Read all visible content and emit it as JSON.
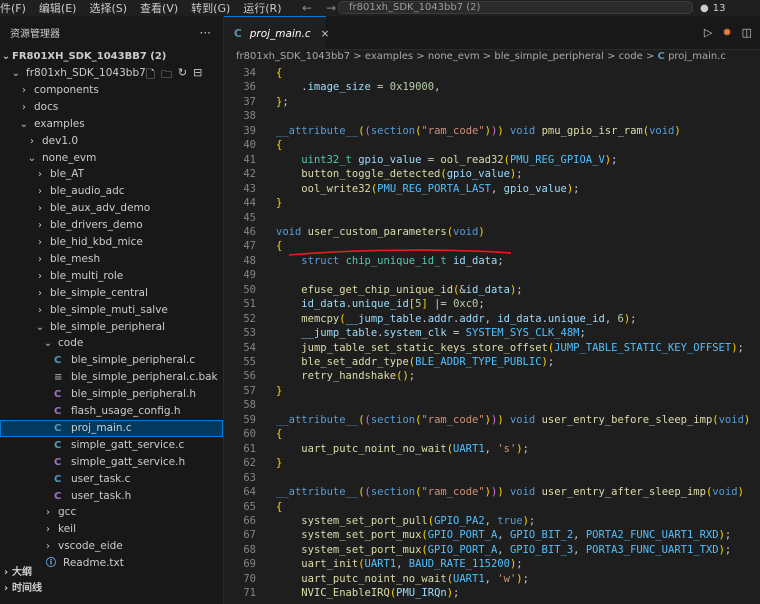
{
  "menubar": {
    "items": [
      "件(F)",
      "编辑(E)",
      "选择(S)",
      "查看(V)",
      "转到(G)",
      "运行(R)"
    ]
  },
  "command_center": {
    "text": "fr801xh_SDK_1043bb7 (2)"
  },
  "notification_count": "13",
  "explorer": {
    "title": "资源管理器",
    "root": "FR801XH_SDK_1043BB7 (2)",
    "tree": [
      {
        "label": "fr801xh_SDK_1043bb7",
        "kind": "folder-open",
        "depth": 1
      },
      {
        "label": "components",
        "kind": "folder",
        "depth": 2
      },
      {
        "label": "docs",
        "kind": "folder",
        "depth": 2
      },
      {
        "label": "examples",
        "kind": "folder-open",
        "depth": 2
      },
      {
        "label": "dev1.0",
        "kind": "folder",
        "depth": 3
      },
      {
        "label": "none_evm",
        "kind": "folder-open",
        "depth": 3
      },
      {
        "label": "ble_AT",
        "kind": "folder",
        "depth": 4
      },
      {
        "label": "ble_audio_adc",
        "kind": "folder",
        "depth": 4
      },
      {
        "label": "ble_aux_adv_demo",
        "kind": "folder",
        "depth": 4
      },
      {
        "label": "ble_drivers_demo",
        "kind": "folder",
        "depth": 4
      },
      {
        "label": "ble_hid_kbd_mice",
        "kind": "folder",
        "depth": 4
      },
      {
        "label": "ble_mesh",
        "kind": "folder",
        "depth": 4
      },
      {
        "label": "ble_multi_role",
        "kind": "folder",
        "depth": 4
      },
      {
        "label": "ble_simple_central",
        "kind": "folder",
        "depth": 4
      },
      {
        "label": "ble_simple_muti_salve",
        "kind": "folder",
        "depth": 4
      },
      {
        "label": "ble_simple_peripheral",
        "kind": "folder-open",
        "depth": 4
      },
      {
        "label": "code",
        "kind": "folder-open",
        "depth": 5
      },
      {
        "label": "ble_simple_peripheral.c",
        "kind": "c",
        "depth": 6
      },
      {
        "label": "ble_simple_peripheral.c.bak",
        "kind": "bak",
        "depth": 6
      },
      {
        "label": "ble_simple_peripheral.h",
        "kind": "h",
        "depth": 6
      },
      {
        "label": "flash_usage_config.h",
        "kind": "h",
        "depth": 6
      },
      {
        "label": "proj_main.c",
        "kind": "c",
        "depth": 6,
        "selected": true
      },
      {
        "label": "simple_gatt_service.c",
        "kind": "c",
        "depth": 6
      },
      {
        "label": "simple_gatt_service.h",
        "kind": "h",
        "depth": 6
      },
      {
        "label": "user_task.c",
        "kind": "c",
        "depth": 6
      },
      {
        "label": "user_task.h",
        "kind": "h",
        "depth": 6
      },
      {
        "label": "gcc",
        "kind": "folder",
        "depth": 5
      },
      {
        "label": "keil",
        "kind": "folder",
        "depth": 5
      },
      {
        "label": "vscode_eide",
        "kind": "folder",
        "depth": 5
      },
      {
        "label": "Readme.txt",
        "kind": "info",
        "depth": 5
      }
    ],
    "sections": [
      "大纲",
      "时间线"
    ]
  },
  "editor": {
    "tab_label": "proj_main.c",
    "breadcrumb": [
      "fr801xh_SDK_1043bb7",
      "examples",
      "none_evm",
      "ble_simple_peripheral",
      "code",
      "proj_main.c"
    ],
    "lines": [
      {
        "n": "34",
        "text": "{"
      },
      {
        "n": "36",
        "text": "    .image_size = 0x19000,"
      },
      {
        "n": "37",
        "text": "};"
      },
      {
        "n": "38",
        "text": ""
      },
      {
        "n": "39",
        "text": "__attribute__((section(\"ram_code\"))) void pmu_gpio_isr_ram(void)"
      },
      {
        "n": "40",
        "text": "{"
      },
      {
        "n": "41",
        "text": "    uint32_t gpio_value = ool_read32(PMU_REG_GPIOA_V);"
      },
      {
        "n": "42",
        "text": "    button_toggle_detected(gpio_value);"
      },
      {
        "n": "43",
        "text": "    ool_write32(PMU_REG_PORTA_LAST, gpio_value);"
      },
      {
        "n": "44",
        "text": "}"
      },
      {
        "n": "45",
        "text": ""
      },
      {
        "n": "46",
        "text": "void user_custom_parameters(void)"
      },
      {
        "n": "47",
        "text": "{"
      },
      {
        "n": "48",
        "text": "    struct chip_unique_id_t id_data;"
      },
      {
        "n": "49",
        "text": ""
      },
      {
        "n": "50",
        "text": "    efuse_get_chip_unique_id(&id_data);"
      },
      {
        "n": "51",
        "text": "    id_data.unique_id[5] |= 0xc0;"
      },
      {
        "n": "52",
        "text": "    memcpy(__jump_table.addr.addr, id_data.unique_id, 6);"
      },
      {
        "n": "53",
        "text": "    __jump_table.system_clk = SYSTEM_SYS_CLK_48M;"
      },
      {
        "n": "54",
        "text": "    jump_table_set_static_keys_store_offset(JUMP_TABLE_STATIC_KEY_OFFSET);"
      },
      {
        "n": "55",
        "text": "    ble_set_addr_type(BLE_ADDR_TYPE_PUBLIC);"
      },
      {
        "n": "56",
        "text": "    retry_handshake();"
      },
      {
        "n": "57",
        "text": "}"
      },
      {
        "n": "58",
        "text": ""
      },
      {
        "n": "59",
        "text": "__attribute__((section(\"ram_code\"))) void user_entry_before_sleep_imp(void)"
      },
      {
        "n": "60",
        "text": "{"
      },
      {
        "n": "61",
        "text": "    uart_putc_noint_no_wait(UART1, 's');"
      },
      {
        "n": "62",
        "text": "}"
      },
      {
        "n": "63",
        "text": ""
      },
      {
        "n": "64",
        "text": "__attribute__((section(\"ram_code\"))) void user_entry_after_sleep_imp(void)"
      },
      {
        "n": "65",
        "text": "{"
      },
      {
        "n": "66",
        "text": "    system_set_port_pull(GPIO_PA2, true);"
      },
      {
        "n": "67",
        "text": "    system_set_port_mux(GPIO_PORT_A, GPIO_BIT_2, PORTA2_FUNC_UART1_RXD);"
      },
      {
        "n": "68",
        "text": "    system_set_port_mux(GPIO_PORT_A, GPIO_BIT_3, PORTA3_FUNC_UART1_TXD);"
      },
      {
        "n": "69",
        "text": "    uart_init(UART1, BAUD_RATE_115200);"
      },
      {
        "n": "70",
        "text": "    uart_putc_noint_no_wait(UART1, 'w');"
      },
      {
        "n": "71",
        "text": "    NVIC_EnableIRQ(PMU_IRQn);"
      }
    ]
  },
  "colors": {
    "accent": "#0078d4",
    "annotation_underline": "#e0201c"
  }
}
